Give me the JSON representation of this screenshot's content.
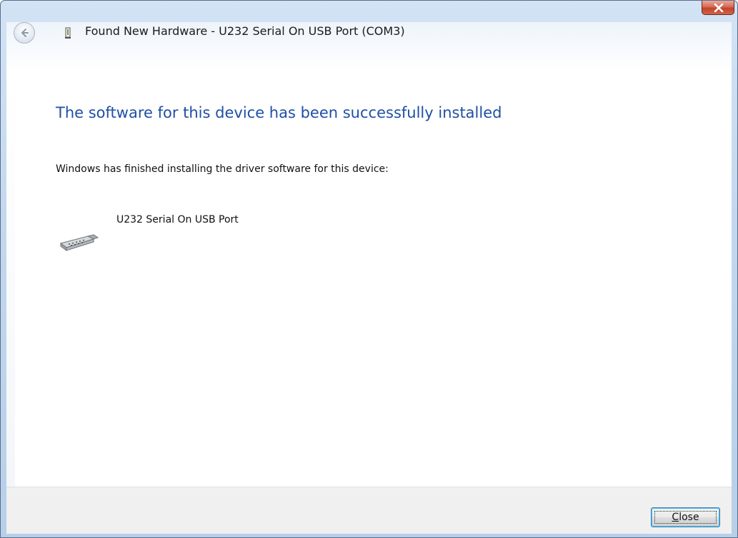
{
  "window": {
    "title": "Found New Hardware - U232 Serial On USB Port (COM3)"
  },
  "title_bar": {
    "close_icon": "close-x-icon",
    "back_icon": "back-arrow-icon",
    "title_icon": "hardware-device-icon"
  },
  "content": {
    "headline": "The software for this device has been successfully installed",
    "description": "Windows has finished installing the driver software for this device:",
    "device": {
      "name": "U232 Serial On USB Port",
      "icon": "serial-port-connector-icon"
    }
  },
  "footer": {
    "close_button": {
      "accelerator": "C",
      "rest": "lose"
    }
  },
  "colors": {
    "headline": "#1f4fa5",
    "frame": "#c3d8ef",
    "close_red": "#c3432a"
  }
}
